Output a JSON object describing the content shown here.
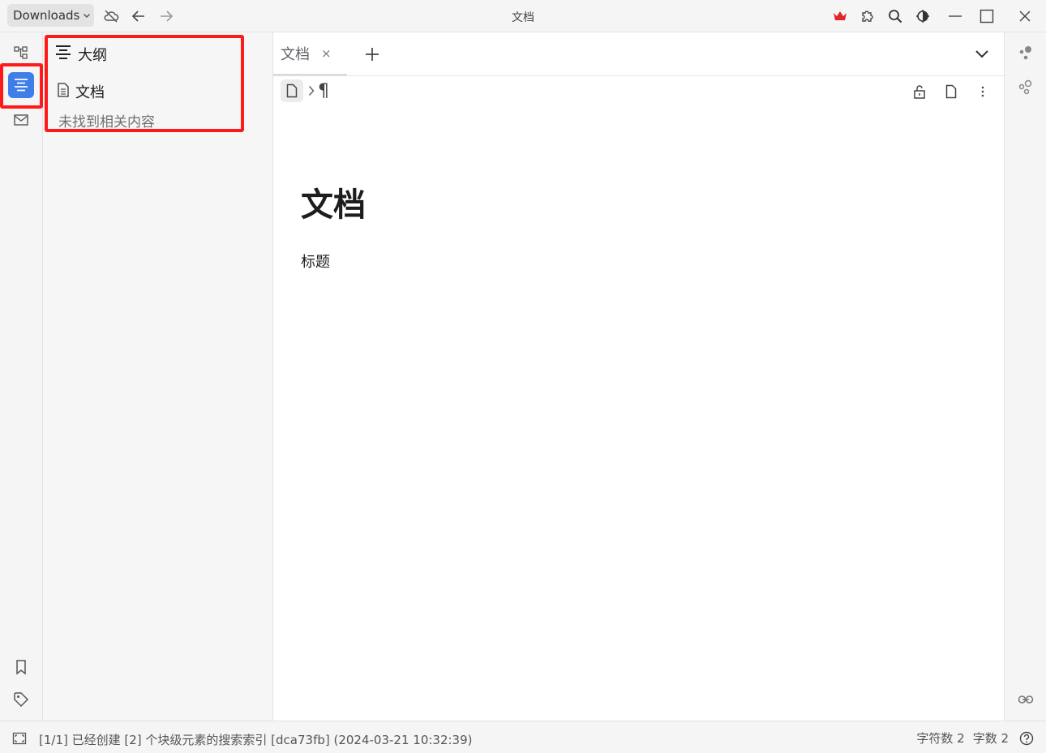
{
  "titlebar": {
    "workspace_label": "Downloads",
    "window_title": "文档",
    "icons": [
      "cloud-off-icon",
      "back-arrow-icon",
      "forward-arrow-icon",
      "crown-icon",
      "plugin-icon",
      "search-icon",
      "theme-icon",
      "minimize-icon",
      "maximize-icon",
      "close-icon"
    ],
    "crown_color": "#e0262c"
  },
  "dock_left": {
    "items": [
      "file-tree-icon",
      "outline-icon",
      "inbox-icon"
    ],
    "active_color": "#3f7de9",
    "bottom_items": [
      "bookmark-icon",
      "tag-icon"
    ]
  },
  "outline": {
    "title": "大纲",
    "doc_label": "文档",
    "empty_text": "未找到相关内容"
  },
  "tabs": [
    {
      "label": "文档",
      "close": "×"
    }
  ],
  "editor": {
    "breadcrumb_para": "¶",
    "title": "文档",
    "body": "标题"
  },
  "statusbar": {
    "message": "[1/1] 已经创建 [2] 个块级元素的搜索索引 [dca73fb] (2024-03-21 10:32:39)",
    "char_count": "字符数 2",
    "word_count": "字数 2"
  },
  "highlight_color": "#ff1a1a"
}
